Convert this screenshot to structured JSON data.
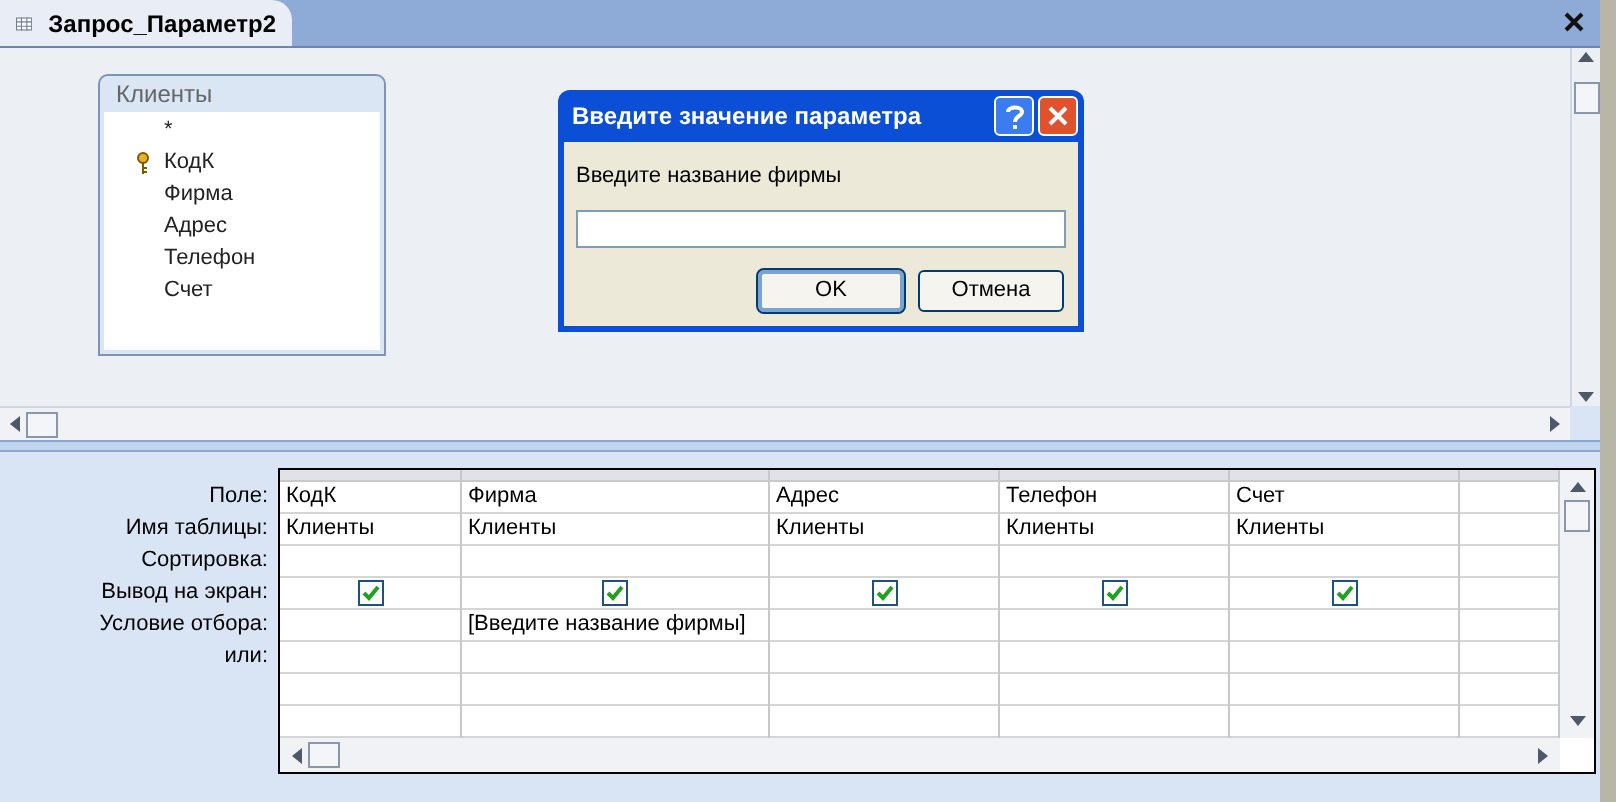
{
  "window": {
    "tab": "Запрос_Параметр2"
  },
  "table_box": {
    "title": "Клиенты",
    "fields": [
      {
        "name": "*",
        "primary_key": false
      },
      {
        "name": "КодК",
        "primary_key": true
      },
      {
        "name": "Фирма",
        "primary_key": false
      },
      {
        "name": "Адрес",
        "primary_key": false
      },
      {
        "name": "Телефон",
        "primary_key": false
      },
      {
        "name": "Счет",
        "primary_key": false
      }
    ]
  },
  "dialog": {
    "title": "Введите значение параметра",
    "prompt": "Введите название фирмы",
    "buttons": [
      {
        "label": "OK",
        "default": true
      },
      {
        "label": "Отмена",
        "default": false
      }
    ]
  },
  "grid": {
    "row_labels": [
      "Поле:",
      "Имя таблицы:",
      "Сортировка:",
      "Вывод на экран:",
      "Условие отбора:",
      "или:"
    ],
    "columns": [
      {
        "field": "КодК",
        "table": "Клиенты",
        "show": true
      },
      {
        "field": "Фирма",
        "table": "Клиенты",
        "show": true,
        "criteria": "[Введите название фирмы]"
      },
      {
        "field": "Адрес",
        "table": "Клиенты",
        "show": true
      },
      {
        "field": "Телефон",
        "table": "Клиенты",
        "show": true
      },
      {
        "field": "Счет",
        "table": "Клиенты",
        "show": true
      }
    ]
  }
}
